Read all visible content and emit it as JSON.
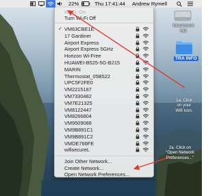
{
  "menubar": {
    "battery_percent": "22%",
    "clock": "Thu 17:41:44",
    "user": "Andrew Rymell"
  },
  "wifi_menu": {
    "status_text": "Wi-Fi: On",
    "turn_off_label": "Turn Wi-Fi Off",
    "networks": [
      {
        "name": "VM63CBE1E",
        "connected": true
      },
      {
        "name": "17 Gardiner"
      },
      {
        "name": "Airport Express"
      },
      {
        "name": "Airport Express 5GHz"
      },
      {
        "name": "Horizon Wi-Free"
      },
      {
        "name": "HUAWEI-B525-5G-B215"
      },
      {
        "name": "MARIN"
      },
      {
        "name": "Thermostat_05B522"
      },
      {
        "name": "UPC5F2FE0"
      },
      {
        "name": "VM2215187"
      },
      {
        "name": "VM7330482"
      },
      {
        "name": "VM7E21325"
      },
      {
        "name": "VM8122447"
      },
      {
        "name": "VM8266804"
      },
      {
        "name": "VM9509088"
      },
      {
        "name": "VM9B891C1"
      },
      {
        "name": "VM9B891C2"
      },
      {
        "name": "VMDE766FE"
      },
      {
        "name": "wifisecureL"
      }
    ],
    "actions": [
      {
        "label": "Join Other Network..."
      },
      {
        "label": "Create Network..."
      },
      {
        "label": "Open Network Preferences..."
      }
    ]
  },
  "desktop": {
    "drive_label_line1": "Macintosh",
    "drive_label_line2": "HD",
    "folder_label": "TRA INFO"
  },
  "annotations": {
    "step1_line1": "1a. Click",
    "step1_line2": "on your",
    "step1_line3": "Wifi icon.",
    "step2_line1": "2a. Click on",
    "step2_line2": "\"Open Network",
    "step2_line3": "Preferences...\""
  },
  "colors": {
    "arrow": "#e23a2c",
    "menu_highlight": "#3c7ae0",
    "folder_blue": "#3e8ee8"
  }
}
